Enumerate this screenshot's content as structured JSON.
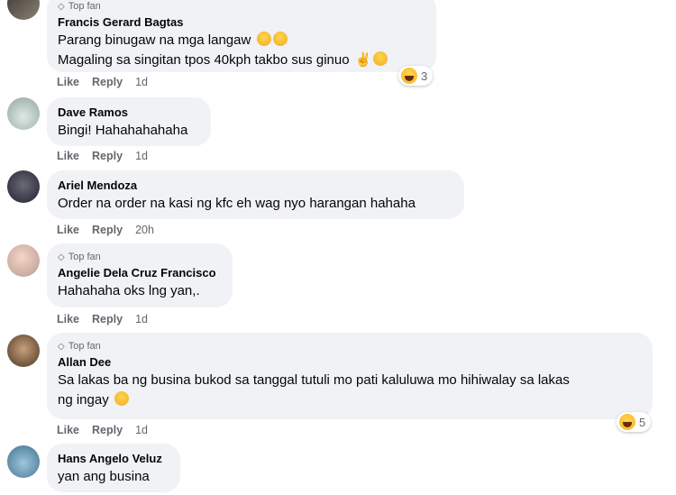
{
  "comments": [
    {
      "top_fan": "Top fan",
      "name": "Francis Gerard Bagtas",
      "lines": [
        "Parang binugaw na mga langaw",
        "Magaling sa singitan tpos 40kph takbo sus ginuo"
      ],
      "like": "Like",
      "reply": "Reply",
      "time": "1d",
      "reaction_count": "3"
    },
    {
      "name": "Dave Ramos",
      "lines": [
        "Bingi! Hahahahahaha"
      ],
      "like": "Like",
      "reply": "Reply",
      "time": "1d"
    },
    {
      "name": "Ariel Mendoza",
      "lines": [
        "Order na order na kasi ng kfc eh wag nyo harangan hahaha"
      ],
      "like": "Like",
      "reply": "Reply",
      "time": "20h"
    },
    {
      "top_fan": "Top fan",
      "name": "Angelie Dela Cruz Francisco",
      "lines": [
        "Hahahaha oks lng yan,."
      ],
      "like": "Like",
      "reply": "Reply",
      "time": "1d"
    },
    {
      "top_fan": "Top fan",
      "name": "Allan Dee",
      "lines": [
        "Sa lakas ba ng busina bukod sa tanggal tutuli mo pati kaluluwa mo hihiwalay sa lakas",
        "ng ingay"
      ],
      "like": "Like",
      "reply": "Reply",
      "time": "1d",
      "reaction_count": "5"
    },
    {
      "name": "Hans Angelo Veluz",
      "lines": [
        "yan ang busina"
      ]
    }
  ],
  "colors": {
    "bubble": "#f0f2f5",
    "meta": "#65676b",
    "text": "#050505"
  }
}
